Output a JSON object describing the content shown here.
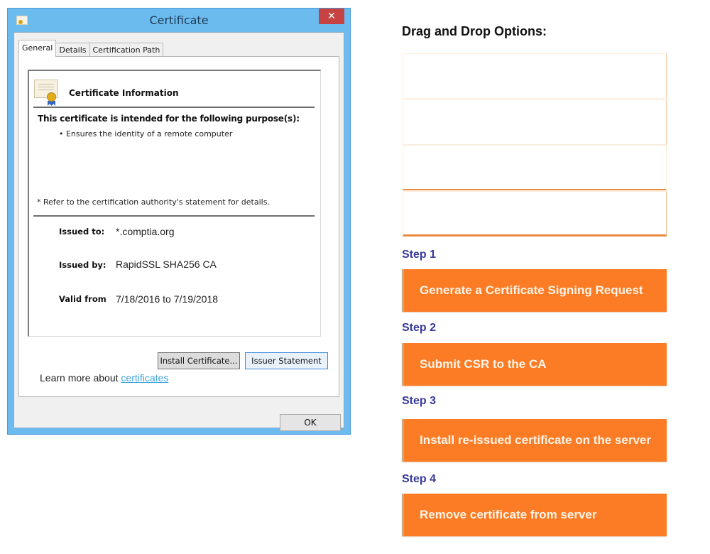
{
  "window": {
    "title": "Certificate",
    "close_icon": "close-icon",
    "tabs": [
      {
        "label": "General",
        "active": true
      },
      {
        "label": "Details",
        "active": false
      },
      {
        "label": "Certification Path",
        "active": false
      }
    ],
    "info": {
      "heading": "Certificate Information",
      "purpose_heading": "This certificate is intended for the following purpose(s):",
      "purposes": [
        "• Ensures the identity of a remote computer"
      ],
      "refer_note": "* Refer to the certification authority's statement for details.",
      "fields": [
        {
          "label": "Issued to:",
          "value": "*.comptia.org"
        },
        {
          "label": "Issued by:",
          "value": "RapidSSL SHA256 CA"
        },
        {
          "label": "Valid from",
          "value": "7/18/2016 to 7/19/2018"
        }
      ]
    },
    "buttons": {
      "install": "Install Certificate...",
      "issuer": "Issuer Statement",
      "ok": "OK"
    },
    "learn_more": {
      "prefix": "Learn more about ",
      "link": "certificates"
    }
  },
  "dnd": {
    "title": "Drag and Drop Options:",
    "option_slots": [
      "",
      "",
      "",
      ""
    ],
    "steps": [
      {
        "label": "Step 1",
        "value": "Generate a Certificate Signing Request"
      },
      {
        "label": "Step 2",
        "value": "Submit CSR to the CA"
      },
      {
        "label": "Step 3",
        "value": "Install re-issued certificate on the server"
      },
      {
        "label": "Step 4",
        "value": "Remove certificate from server"
      }
    ],
    "colors": {
      "accent": "#fb7c25",
      "step_label": "#37399a"
    }
  }
}
